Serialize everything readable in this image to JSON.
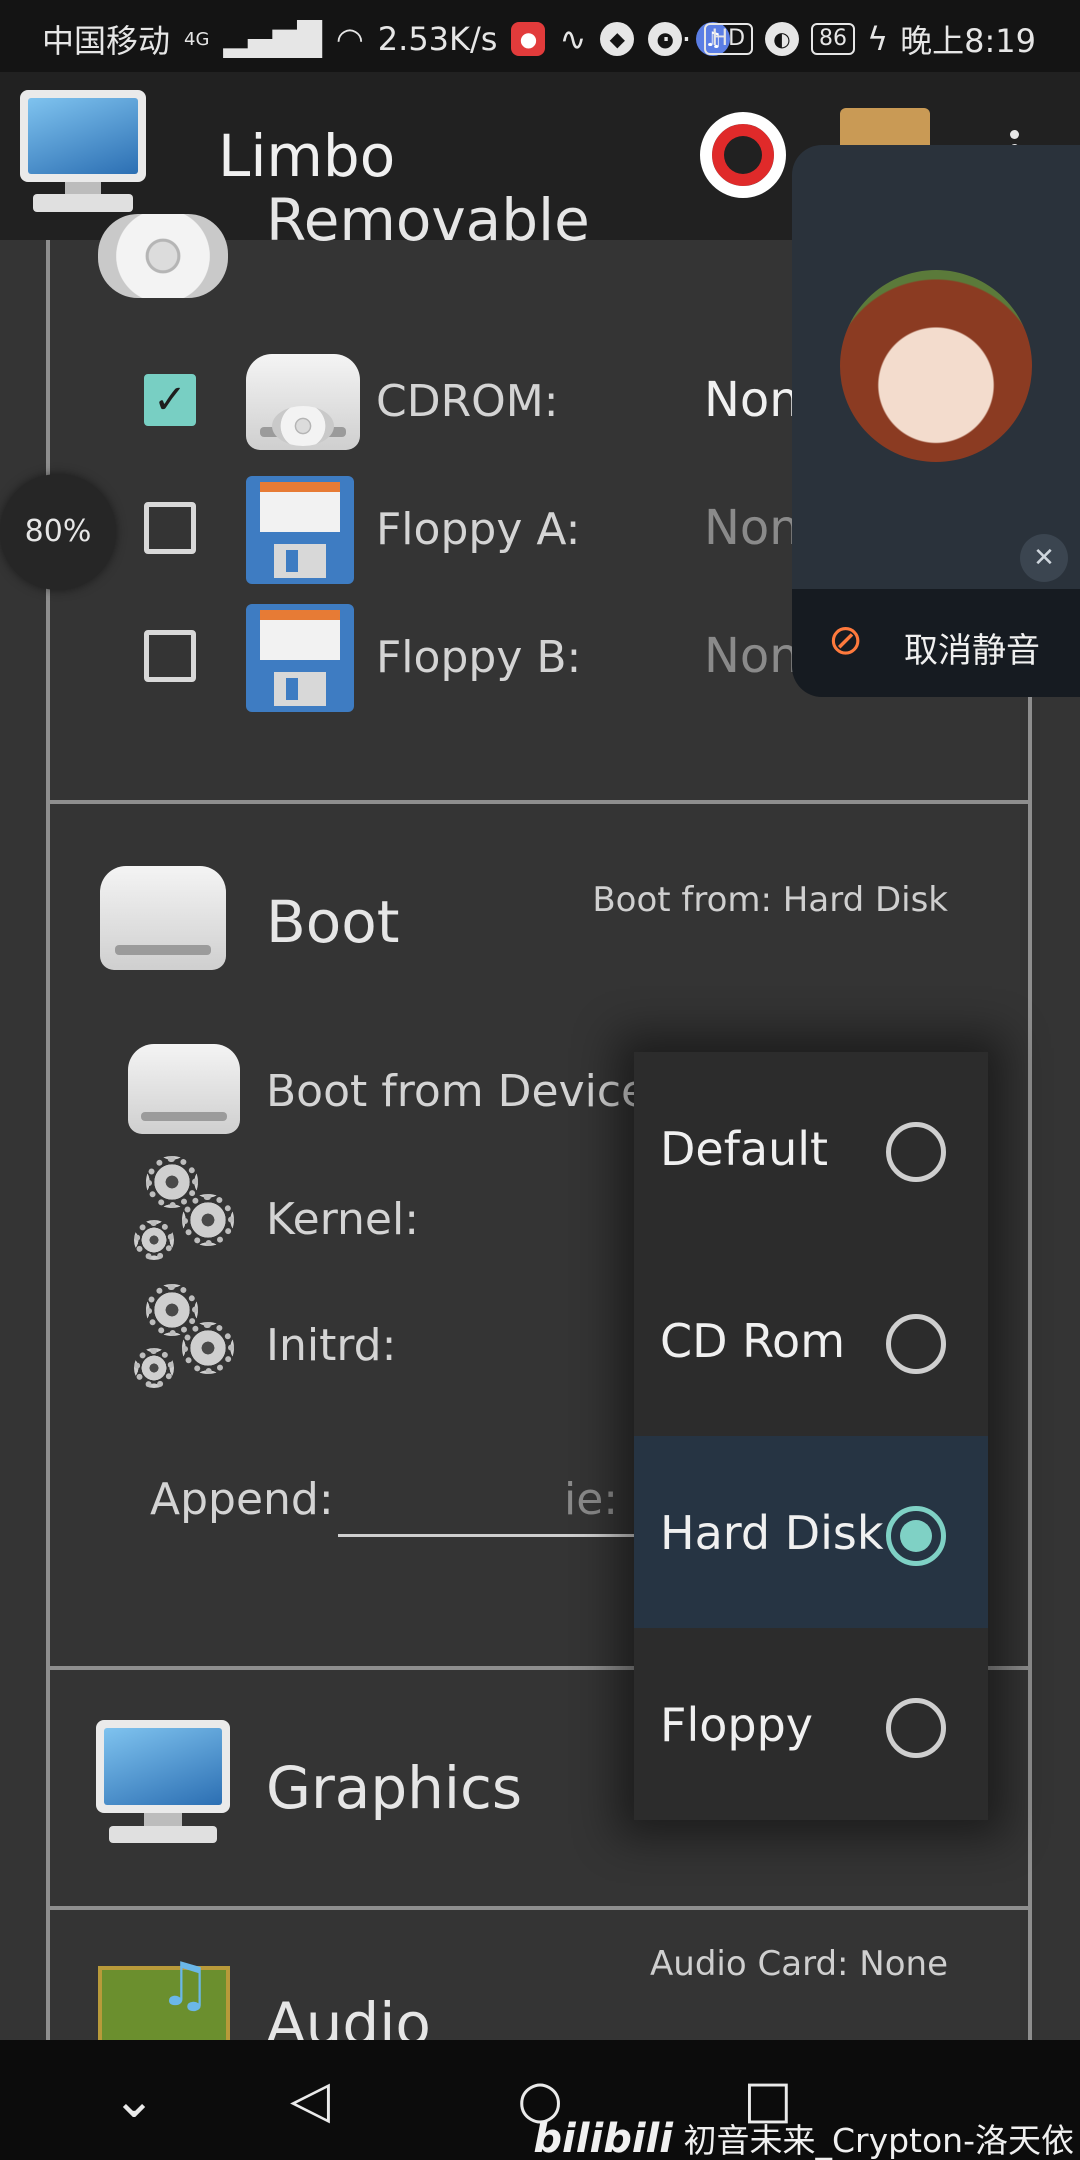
{
  "status_bar": {
    "carrier": "中国移动",
    "network": "4G",
    "speed": "2.53K/s",
    "hd_badge": "HD",
    "battery": "86",
    "time": "晚上8:19"
  },
  "app_bar": {
    "title": "Limbo",
    "icons": [
      "computer-icon",
      "help-lifebuoy-icon",
      "box-icon",
      "overflow-menu-icon"
    ]
  },
  "removable": {
    "title": "Removable",
    "rows": [
      {
        "label": "CDROM:",
        "value": "Non",
        "checked": true
      },
      {
        "label": "Floppy A:",
        "value": "Non",
        "checked": false
      },
      {
        "label": "Floppy B:",
        "value": "Non",
        "checked": false
      }
    ]
  },
  "boot": {
    "title": "Boot",
    "status": "Boot from: Hard Disk",
    "device_label": "Boot from Device:",
    "kernel_label": "Kernel:",
    "initrd_label": "Initrd:",
    "append_label": "Append:",
    "append_placeholder": "ie: r"
  },
  "boot_menu": {
    "options": [
      {
        "label": "Default",
        "selected": false
      },
      {
        "label": "CD Rom",
        "selected": false
      },
      {
        "label": "Hard Disk",
        "selected": true
      },
      {
        "label": "Floppy",
        "selected": false
      }
    ],
    "accent": "#7fd1c5"
  },
  "graphics": {
    "title": "Graphics"
  },
  "audio": {
    "title": "Audio",
    "status": "Audio Card: None"
  },
  "zoom": "80%",
  "call_overlay": {
    "unmute_label": "取消静音"
  },
  "nav_bar": {
    "watermark": "初音未来_Crypton-洛天依",
    "watermark_brand": "bilibili"
  }
}
